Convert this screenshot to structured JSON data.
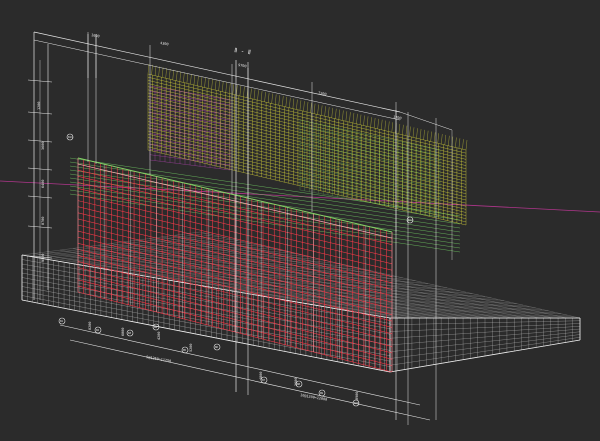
{
  "viewport": {
    "background": "#2b2b2b",
    "colors": {
      "dimension": "#e8e8e8",
      "rebar_red": "#ff3b4a",
      "rebar_yellow": "#d6d43a",
      "rebar_green": "#7be36a",
      "rebar_magenta": "#d24ad0",
      "mesh": "#d8d8d8",
      "axis": "#b0368c"
    }
  },
  "drawing": {
    "section_title": "Ⅱ - Ⅱ",
    "top_dims": [
      "1600",
      "4300",
      "9700",
      "7200",
      "1700"
    ],
    "left_dims": [
      "1200",
      "3600",
      "6400",
      "8700",
      "9500"
    ],
    "bottom_dims": [
      "8200",
      "6000",
      "4200",
      "5200",
      "4800",
      "3600",
      "8900"
    ],
    "bottom_spans": [
      "9@1250=11250",
      "10@1200=12000"
    ],
    "rebar_tags": [
      "N1",
      "N2",
      "N3",
      "N4",
      "N5",
      "N6",
      "N7",
      "N8",
      "N9",
      "N10",
      "N11",
      "N12"
    ]
  }
}
